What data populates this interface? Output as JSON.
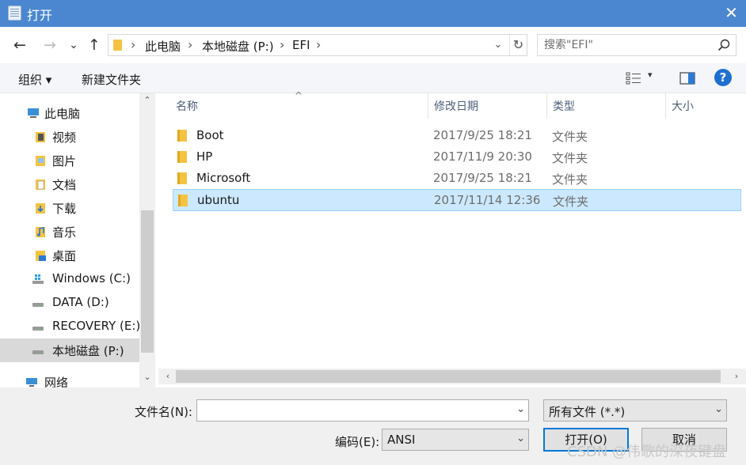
{
  "window": {
    "title": "打开",
    "close_glyph": "✕"
  },
  "nav": {
    "back_glyph": "←",
    "forward_glyph": "→",
    "recent_glyph": "⌄",
    "up_glyph": "↑"
  },
  "address": {
    "crumbs": [
      "此电脑",
      "本地磁盘 (P:)",
      "EFI"
    ],
    "separator": "›",
    "drop_glyph": "⌄",
    "refresh_glyph": "↻"
  },
  "search": {
    "placeholder": "搜索\"EFI\"",
    "icon": "search-icon"
  },
  "toolbar": {
    "organize_label": "组织 ▾",
    "new_folder_label": "新建文件夹",
    "view_drop_glyph": "▾",
    "help_label": "?"
  },
  "sidebar": {
    "items": [
      {
        "label": "此电脑",
        "icon": "computer-icon"
      },
      {
        "label": "视频",
        "icon": "video-folder-icon"
      },
      {
        "label": "图片",
        "icon": "pictures-folder-icon"
      },
      {
        "label": "文档",
        "icon": "documents-folder-icon"
      },
      {
        "label": "下载",
        "icon": "downloads-folder-icon"
      },
      {
        "label": "音乐",
        "icon": "music-folder-icon"
      },
      {
        "label": "桌面",
        "icon": "desktop-folder-icon"
      },
      {
        "label": "Windows (C:)",
        "icon": "windows-drive-icon"
      },
      {
        "label": "DATA (D:)",
        "icon": "drive-icon"
      },
      {
        "label": "RECOVERY (E:)",
        "icon": "drive-icon"
      },
      {
        "label": "本地磁盘 (P:)",
        "icon": "drive-icon",
        "selected": true
      },
      {
        "label": "网络",
        "icon": "network-icon"
      }
    ],
    "scroll_up_glyph": "⌃",
    "scroll_down_glyph": "⌄"
  },
  "filelist": {
    "columns": [
      "名称",
      "修改日期",
      "类型",
      "大小"
    ],
    "sort_glyph": "^",
    "rows": [
      {
        "name": "Boot",
        "date": "2017/9/25 18:21",
        "type": "文件夹"
      },
      {
        "name": "HP",
        "date": "2017/11/9 20:30",
        "type": "文件夹"
      },
      {
        "name": "Microsoft",
        "date": "2017/9/25 18:21",
        "type": "文件夹"
      },
      {
        "name": "ubuntu",
        "date": "2017/11/14 12:36",
        "type": "文件夹",
        "selected": true
      }
    ],
    "hscroll_left_glyph": "‹",
    "hscroll_right_glyph": "›"
  },
  "bottom": {
    "filename_label": "文件名(N):",
    "filename_value": "",
    "filetype_value": "所有文件  (*.*)",
    "encoding_label": "编码(E):",
    "encoding_value": "ANSI",
    "open_label": "打开(O)",
    "cancel_label": "取消",
    "combo_glyph": "⌄"
  },
  "watermark": "CSDN @伟歌的深夜键盘",
  "colors": {
    "titlebar": "#4a87d0",
    "selection": "#cce8ff",
    "selection_border": "#99d1ff",
    "folder": "#f5c342",
    "accent": "#0078d7"
  }
}
